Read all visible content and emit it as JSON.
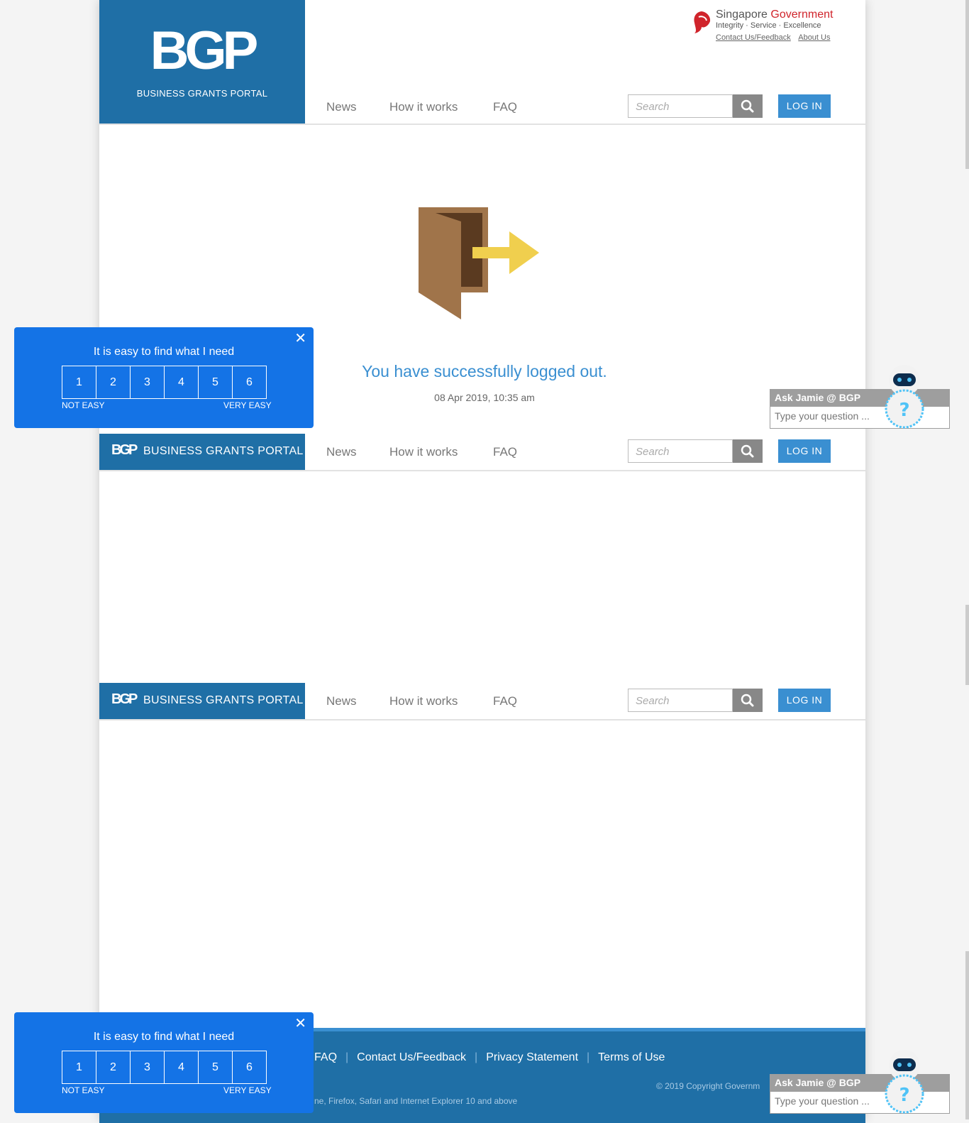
{
  "header": {
    "logo_mark": "BGP",
    "logo_tagline": "BUSINESS GRANTS PORTAL",
    "gov_name": "Singapore",
    "gov_name_accent": "Government",
    "gov_motto": "Integrity · Service · Excellence",
    "gov_links": [
      "Contact Us/Feedback",
      "About Us"
    ]
  },
  "nav": {
    "items": [
      "News",
      "How it works",
      "FAQ"
    ],
    "search_placeholder": "Search",
    "login_label": "LOG IN"
  },
  "sticky_logo": {
    "mark": "BGP",
    "text": "BUSINESS GRANTS PORTAL"
  },
  "main": {
    "message": "You have successfully logged out.",
    "timestamp": "08 Apr 2019, 10:35 am"
  },
  "survey": {
    "question": "It is easy to find what I need",
    "options": [
      "1",
      "2",
      "3",
      "4",
      "5",
      "6"
    ],
    "low_label": "NOT EASY",
    "high_label": "VERY EASY",
    "close_icon": "close-icon"
  },
  "chat": {
    "title": "Ask Jamie @ BGP",
    "placeholder": "Type your question ..."
  },
  "footer": {
    "links": [
      "FAQ",
      "Contact Us/Feedback",
      "Privacy Statement",
      "Terms of Use"
    ],
    "copyright": "© 2019 Copyright Governm",
    "browsers": "ne, Firefox, Safari and Internet Explorer 10 and above"
  },
  "colors": {
    "brand_blue": "#1f6fa6",
    "accent_blue": "#3a8fd1",
    "survey_blue": "#1473e6",
    "gov_red": "#d0242b"
  }
}
